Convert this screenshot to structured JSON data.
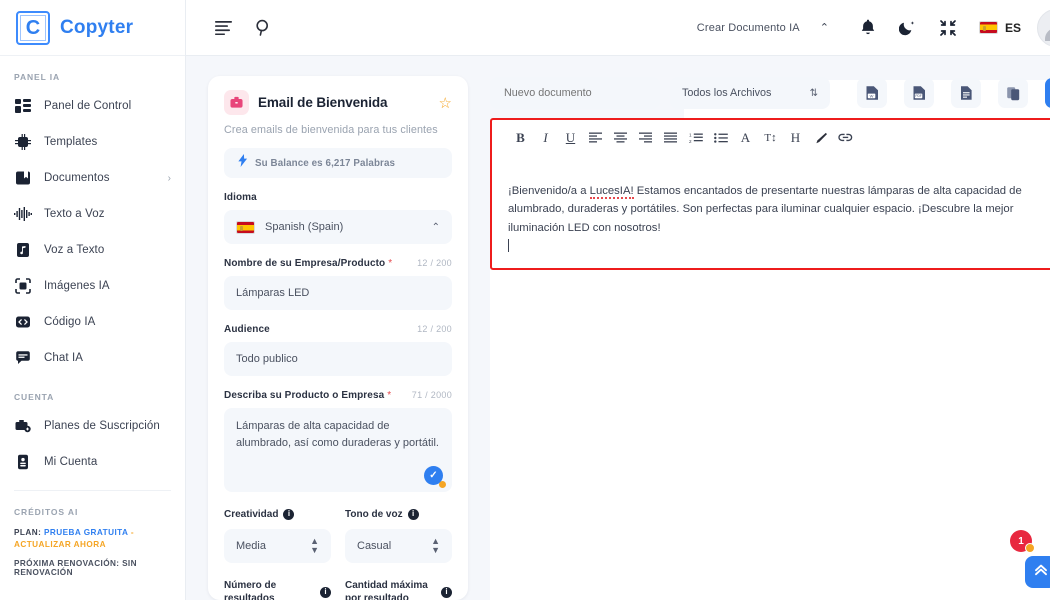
{
  "brand": {
    "mark": "C",
    "name": "Copyter"
  },
  "sidebar": {
    "section_panel": "PANEL IA",
    "items": [
      {
        "label": "Panel de Control",
        "icon": "dashboard-icon"
      },
      {
        "label": "Templates",
        "icon": "chip-ai-icon"
      },
      {
        "label": "Documentos",
        "icon": "book-icon",
        "caret": "›"
      },
      {
        "label": "Texto a Voz",
        "icon": "waveform-icon"
      },
      {
        "label": "Voz a Texto",
        "icon": "music-file-icon"
      },
      {
        "label": "Imágenes IA",
        "icon": "camera-frame-icon"
      },
      {
        "label": "Código IA",
        "icon": "code-icon"
      },
      {
        "label": "Chat IA",
        "icon": "chat-icon"
      }
    ],
    "section_account": "CUENTA",
    "account_items": [
      {
        "label": "Planes de Suscripción",
        "icon": "subscription-icon"
      },
      {
        "label": "Mi Cuenta",
        "icon": "id-card-icon"
      }
    ],
    "section_credits": "CRÉDITOS AI",
    "plan_prefix": "PLAN:",
    "plan_value": "PRUEBA GRATUITA",
    "plan_dash": "-",
    "plan_upgrade": "ACTUALIZAR AHORA",
    "renewal": "PRÓXIMA RENOVACIÓN: SIN RENOVACIÓN"
  },
  "topbar": {
    "menu_icon": "menu-lines-icon",
    "search_icon": "search-icon",
    "create_doc": "Crear Documento IA",
    "chevron": "⌃",
    "bell_icon": "bell-icon",
    "moon_icon": "moon-icon",
    "compress_icon": "compress-icon",
    "lang_code": "ES",
    "avatar": "user-avatar"
  },
  "template_card": {
    "icon": "briefcase-icon",
    "title": "Email de Bienvenida",
    "star": "☆",
    "subtitle": "Crea emails de bienvenida para tus clientes",
    "balance_icon": "lightning-icon",
    "balance_text": "Su Balance es 6,217 Palabras",
    "language_label": "Idioma",
    "language_value": "Spanish (Spain)",
    "language_caret": "⌃",
    "fields": [
      {
        "label": "Nombre de su Empresa/Producto",
        "required": "*",
        "counter": "12 / 200",
        "value": "Lámparas LED",
        "type": "input"
      },
      {
        "label": "Audience",
        "required": "",
        "counter": "12 / 200",
        "value": "Todo publico",
        "type": "input"
      },
      {
        "label": "Describa su Producto o Empresa",
        "required": "*",
        "counter": "71 / 2000",
        "value": "Lámparas de alta capacidad de alumbrado, así como duraderas y portátil.",
        "type": "textarea"
      }
    ],
    "options": [
      {
        "label": "Creatividad",
        "value": "Media"
      },
      {
        "label": "Tono de voz",
        "value": "Casual"
      }
    ],
    "options_row2": [
      {
        "label": "Número de resultados"
      },
      {
        "label": "Cantidad máxima por resultado"
      }
    ]
  },
  "editor": {
    "doc_name_value": "",
    "doc_name_placeholder": "Nuevo documento",
    "files_filter": "Todos los Archivos",
    "files_caret": "⇅",
    "export_buttons": [
      {
        "icon": "word-export-icon",
        "label": "W"
      },
      {
        "icon": "pdf-export-icon",
        "label": "PDF"
      },
      {
        "icon": "text-file-icon",
        "label": ""
      },
      {
        "icon": "copy-icon",
        "label": ""
      },
      {
        "icon": "save-document-icon",
        "label": ""
      }
    ],
    "rte_buttons": [
      {
        "icon": "bold-icon",
        "glyph": "B"
      },
      {
        "icon": "italic-icon",
        "glyph": "I"
      },
      {
        "icon": "underline-icon",
        "glyph": "U"
      },
      {
        "icon": "align-left-icon",
        "glyph": ""
      },
      {
        "icon": "align-center-icon",
        "glyph": ""
      },
      {
        "icon": "align-right-icon",
        "glyph": ""
      },
      {
        "icon": "align-justify-icon",
        "glyph": ""
      },
      {
        "icon": "ordered-list-icon",
        "glyph": ""
      },
      {
        "icon": "unordered-list-icon",
        "glyph": ""
      },
      {
        "icon": "font-family-icon",
        "glyph": "A"
      },
      {
        "icon": "font-size-icon",
        "glyph": "T↕"
      },
      {
        "icon": "heading-icon",
        "glyph": "H"
      },
      {
        "icon": "text-color-icon",
        "glyph": ""
      },
      {
        "icon": "link-icon",
        "glyph": ""
      }
    ],
    "content_pre": "¡Bienvenido/a a ",
    "content_spell": "LucesIA!",
    "content_post": " Estamos encantados de presentarte nuestras lámparas de alta capacidad de alumbrado, duraderas y portátiles. Son perfectas para iluminar cualquier espacio. ¡Descubre la mejor iluminación LED con nosotros!"
  },
  "floating": {
    "badge_count": "1",
    "scroll_top_icon": "chevron-double-up-icon"
  },
  "colors": {
    "brand_blue": "#2f7ff0",
    "accent_orange": "#f5a524",
    "danger_red": "#e8283f",
    "highlight_box": "#ee1c1c",
    "panel_bg": "#f4f7fb"
  }
}
